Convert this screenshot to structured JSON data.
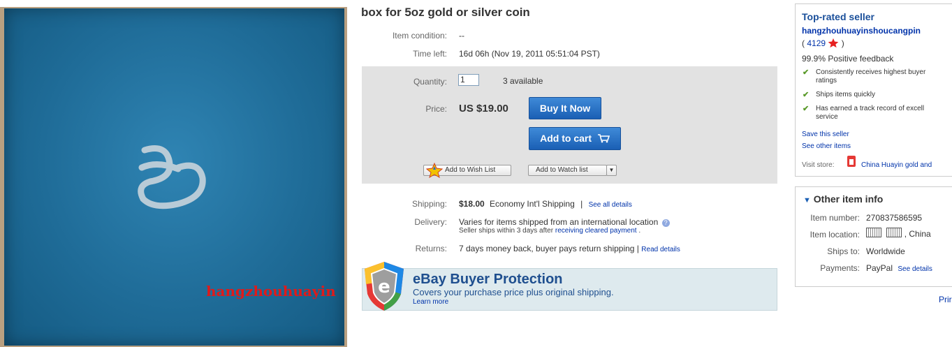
{
  "listing": {
    "title": "box for 5oz gold or silver coin",
    "watermark": "hangzhouhuayin",
    "condition_label": "Item condition:",
    "condition_value": "--",
    "time_label": "Time left:",
    "time_value": "16d 06h (Nov 19, 2011 05:51:04 PST)"
  },
  "buy": {
    "quantity_label": "Quantity:",
    "quantity_value": "1",
    "available": "3 available",
    "price_label": "Price:",
    "price_value": "US $19.00",
    "buy_now": "Buy It Now",
    "add_to_cart": "Add to cart",
    "wish_list": "Add to Wish List",
    "watch_list": "Add to Watch list"
  },
  "shipping": {
    "shipping_label": "Shipping:",
    "cost": "$18.00",
    "method": "Economy Int'l Shipping",
    "sep": "|",
    "see_all": "See all details",
    "delivery_label": "Delivery:",
    "delivery_text": "Varies for items shipped from an international location",
    "delivery_sub": "Seller ships within 3 days after",
    "delivery_link": "receiving cleared payment",
    "delivery_end": ".",
    "returns_label": "Returns:",
    "returns_text": "7 days money back, buyer pays return shipping |",
    "read_details": "Read details"
  },
  "protection": {
    "title": "eBay Buyer Protection",
    "subtitle": "Covers your purchase price plus original shipping.",
    "learn_more": "Learn more"
  },
  "seller": {
    "heading": "Top-rated seller",
    "name": "hangzhouhuayinshoucangpin",
    "score_open": "(",
    "score": "4129",
    "score_close": ")",
    "feedback": "99.9% Positive feedback",
    "bullets": [
      "Consistently receives highest buyer",
      "ratings",
      "Ships items quickly",
      "Has earned a track record of excell",
      "service"
    ],
    "save_seller": "Save this seller",
    "see_other": "See other items",
    "visit_label": "Visit store:",
    "store_name": "China Huayin gold and"
  },
  "other_info": {
    "heading": "Other item info",
    "item_number_label": "Item number:",
    "item_number": "270837586595",
    "location_label": "Item location:",
    "location_country": ", China",
    "ships_label": "Ships to:",
    "ships_value": "Worldwide",
    "payments_label": "Payments:",
    "payments_value": "PayPal",
    "payments_link": "See details",
    "print": "Prir"
  },
  "colors": {
    "accent_blue": "#1a5fb4",
    "link_blue": "#0033aa",
    "check_green": "#5a9a2a",
    "watermark_red": "#e01a1a"
  }
}
